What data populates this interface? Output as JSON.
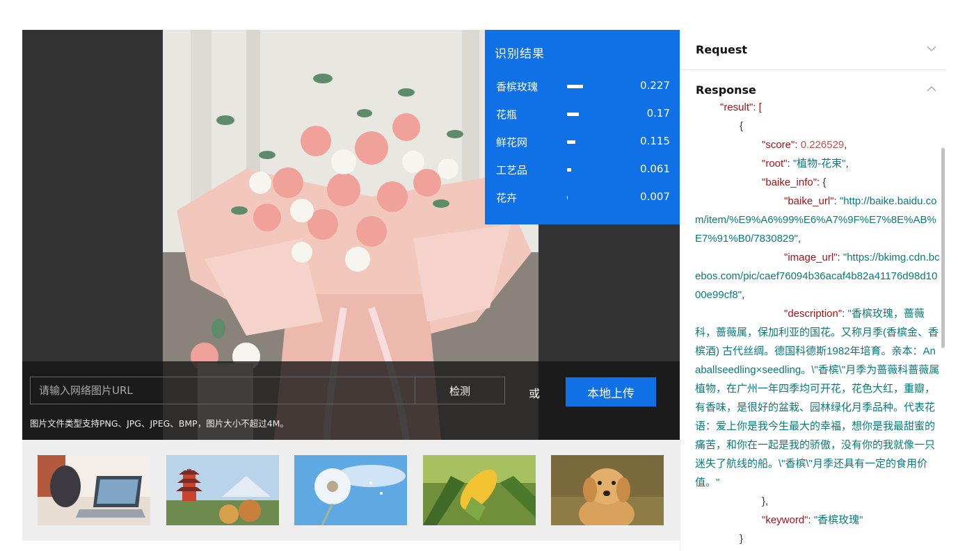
{
  "colors": {
    "accent": "#1070e6",
    "dark_bg": "#333333",
    "thumb_bg": "#eeeeee"
  },
  "result_panel": {
    "title": "识别结果",
    "items": [
      {
        "name": "香槟玫瑰",
        "score": "0.227",
        "bar_fraction": 0.227
      },
      {
        "name": "花瓶",
        "score": "0.17",
        "bar_fraction": 0.17
      },
      {
        "name": "鲜花网",
        "score": "0.115",
        "bar_fraction": 0.115
      },
      {
        "name": "工艺品",
        "score": "0.061",
        "bar_fraction": 0.061
      },
      {
        "name": "花卉",
        "score": "0.007",
        "bar_fraction": 0.007
      }
    ]
  },
  "url_bar": {
    "placeholder": "请输入网络图片URL",
    "detect_label": "检测",
    "or_label": "或",
    "upload_label": "本地上传",
    "hint": "图片文件类型支持PNG、JPG、JPEG、BMP，图片大小不超过4M。"
  },
  "thumbnails": [
    {
      "icon": "laptop-photo"
    },
    {
      "icon": "pagoda-photo"
    },
    {
      "icon": "dandelion-photo"
    },
    {
      "icon": "corn-photo"
    },
    {
      "icon": "dog-photo"
    }
  ],
  "side_panel": {
    "request_label": "Request",
    "response_label": "Response",
    "code": {
      "top_key": "\"result\": [",
      "open_brace": "{",
      "score_key": "\"score\"",
      "score_val": "0.226529",
      "root_key": "\"root\"",
      "root_val": "\"植物-花束\"",
      "baike_key": "\"baike_info\"",
      "baike_url_key": "\"baike_url\"",
      "baike_url_val": "\"http://baike.baidu.com/item/%E9%A6%99%E6%A7%9F%E7%8E%AB%E7%91%B0/7830829\"",
      "image_url_key": "\"image_url\"",
      "image_url_val": "\"https://bkimg.cdn.bcebos.com/pic/caef76094b36acaf4b82a41176d98d1000e99cf8\"",
      "desc_key": "\"description\"",
      "desc_val": "\"香槟玫瑰，蔷薇科，蔷薇属，保加利亚的国花。又称月季(香槟金、香槟酒) 古代丝绸。德国科德斯1982年培育。亲本：Anaballseedling×seedling。\\\"香槟\\\"月季为蔷薇科蔷薇属植物，在广州一年四季均可开花，花色大红，重瓣，有香味，是很好的盆栽、园林绿化月季品种。代表花语：爱上你是我今生最大的幸福，想你是我最甜蜜的痛苦，和你在一起是我的骄傲，没有你的我就像一只迷失了航线的船。\\\"香槟\\\"月季还具有一定的食用价值。\"",
      "close_inner": "},",
      "keyword_key": "\"keyword\"",
      "keyword_val": "\"香槟玫瑰\"",
      "close_brace": "}"
    }
  }
}
